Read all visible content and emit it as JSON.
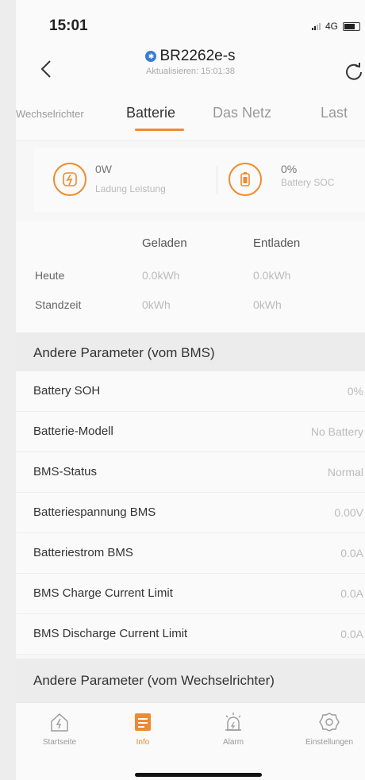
{
  "status": {
    "time": "15:01",
    "network": "4G"
  },
  "header": {
    "device_name": "BR2262e-s",
    "updated": "Aktualisieren: 15:01:38"
  },
  "tabs": [
    {
      "label": "Wechselrichter",
      "active": false
    },
    {
      "label": "Batterie",
      "active": true
    },
    {
      "label": "Das Netz",
      "active": false
    },
    {
      "label": "Last",
      "active": false
    }
  ],
  "summary": {
    "power_value": "0W",
    "power_label": "Ladung Leistung",
    "soc_value": "0%",
    "soc_label": "Battery SOC"
  },
  "stats": {
    "col_charged": "Geladen",
    "col_discharged": "Entladen",
    "rows": [
      {
        "label": "Heute",
        "charged": "0.0kWh",
        "discharged": "0.0kWh"
      },
      {
        "label": "Standzeit",
        "charged": "0kWh",
        "discharged": "0kWh"
      }
    ]
  },
  "bms_section": {
    "title": "Andere Parameter (vom BMS)",
    "rows": [
      {
        "label": "Battery SOH",
        "value": "0%"
      },
      {
        "label": "Batterie-Modell",
        "value": "No Battery"
      },
      {
        "label": "BMS-Status",
        "value": "Normal"
      },
      {
        "label": "Batteriespannung BMS",
        "value": "0.00V"
      },
      {
        "label": "Batteriestrom BMS",
        "value": "0.0A"
      },
      {
        "label": "BMS Charge Current Limit",
        "value": "0.0A"
      },
      {
        "label": "BMS Discharge Current Limit",
        "value": "0.0A"
      }
    ]
  },
  "inverter_section": {
    "title": "Andere Parameter (vom Wechselrichter)"
  },
  "nav": [
    {
      "label": "Startseite",
      "icon": "home-icon",
      "active": false
    },
    {
      "label": "Info",
      "icon": "info-list-icon",
      "active": true
    },
    {
      "label": "Alarm",
      "icon": "alarm-icon",
      "active": false
    },
    {
      "label": "Einstellungen",
      "icon": "gear-icon",
      "active": false
    }
  ],
  "colors": {
    "accent": "#f08a2e",
    "bluetooth": "#3a7bd5"
  }
}
